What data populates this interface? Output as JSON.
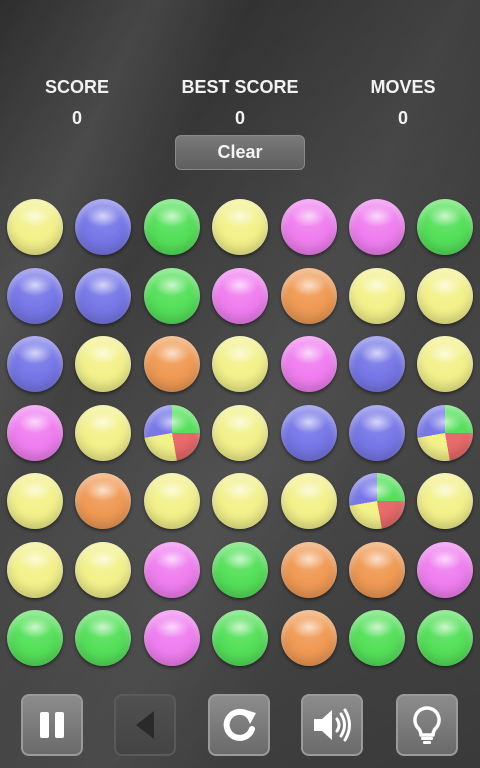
{
  "stats": [
    {
      "label": "SCORE",
      "value": "0"
    },
    {
      "label": "BEST SCORE",
      "value": "0"
    },
    {
      "label": "MOVES",
      "value": "0"
    }
  ],
  "clear_label": "Clear",
  "colors": {
    "yellow": "#f3f18a",
    "blue": "#7777e8",
    "green": "#55e05a",
    "pink": "#f07ef0",
    "orange": "#f09a55"
  },
  "board": [
    [
      "yellow",
      "blue",
      "green",
      "yellow",
      "pink",
      "pink",
      "green"
    ],
    [
      "blue",
      "blue",
      "green",
      "pink",
      "orange",
      "yellow",
      "yellow"
    ],
    [
      "blue",
      "yellow",
      "orange",
      "yellow",
      "pink",
      "blue",
      "yellow"
    ],
    [
      "pink",
      "yellow",
      "multi",
      "yellow",
      "blue",
      "blue",
      "multi"
    ],
    [
      "yellow",
      "orange",
      "yellow",
      "yellow",
      "yellow",
      "multi",
      "yellow"
    ],
    [
      "yellow",
      "yellow",
      "pink",
      "green",
      "orange",
      "orange",
      "pink"
    ],
    [
      "green",
      "green",
      "pink",
      "green",
      "orange",
      "green",
      "green"
    ]
  ],
  "controls": [
    {
      "name": "pause-button",
      "icon": "pause-icon",
      "enabled": true
    },
    {
      "name": "undo-button",
      "icon": "back-arrow-icon",
      "enabled": false
    },
    {
      "name": "restart-button",
      "icon": "restart-icon",
      "enabled": true
    },
    {
      "name": "sound-button",
      "icon": "speaker-icon",
      "enabled": true
    },
    {
      "name": "hint-button",
      "icon": "lightbulb-icon",
      "enabled": true
    }
  ]
}
